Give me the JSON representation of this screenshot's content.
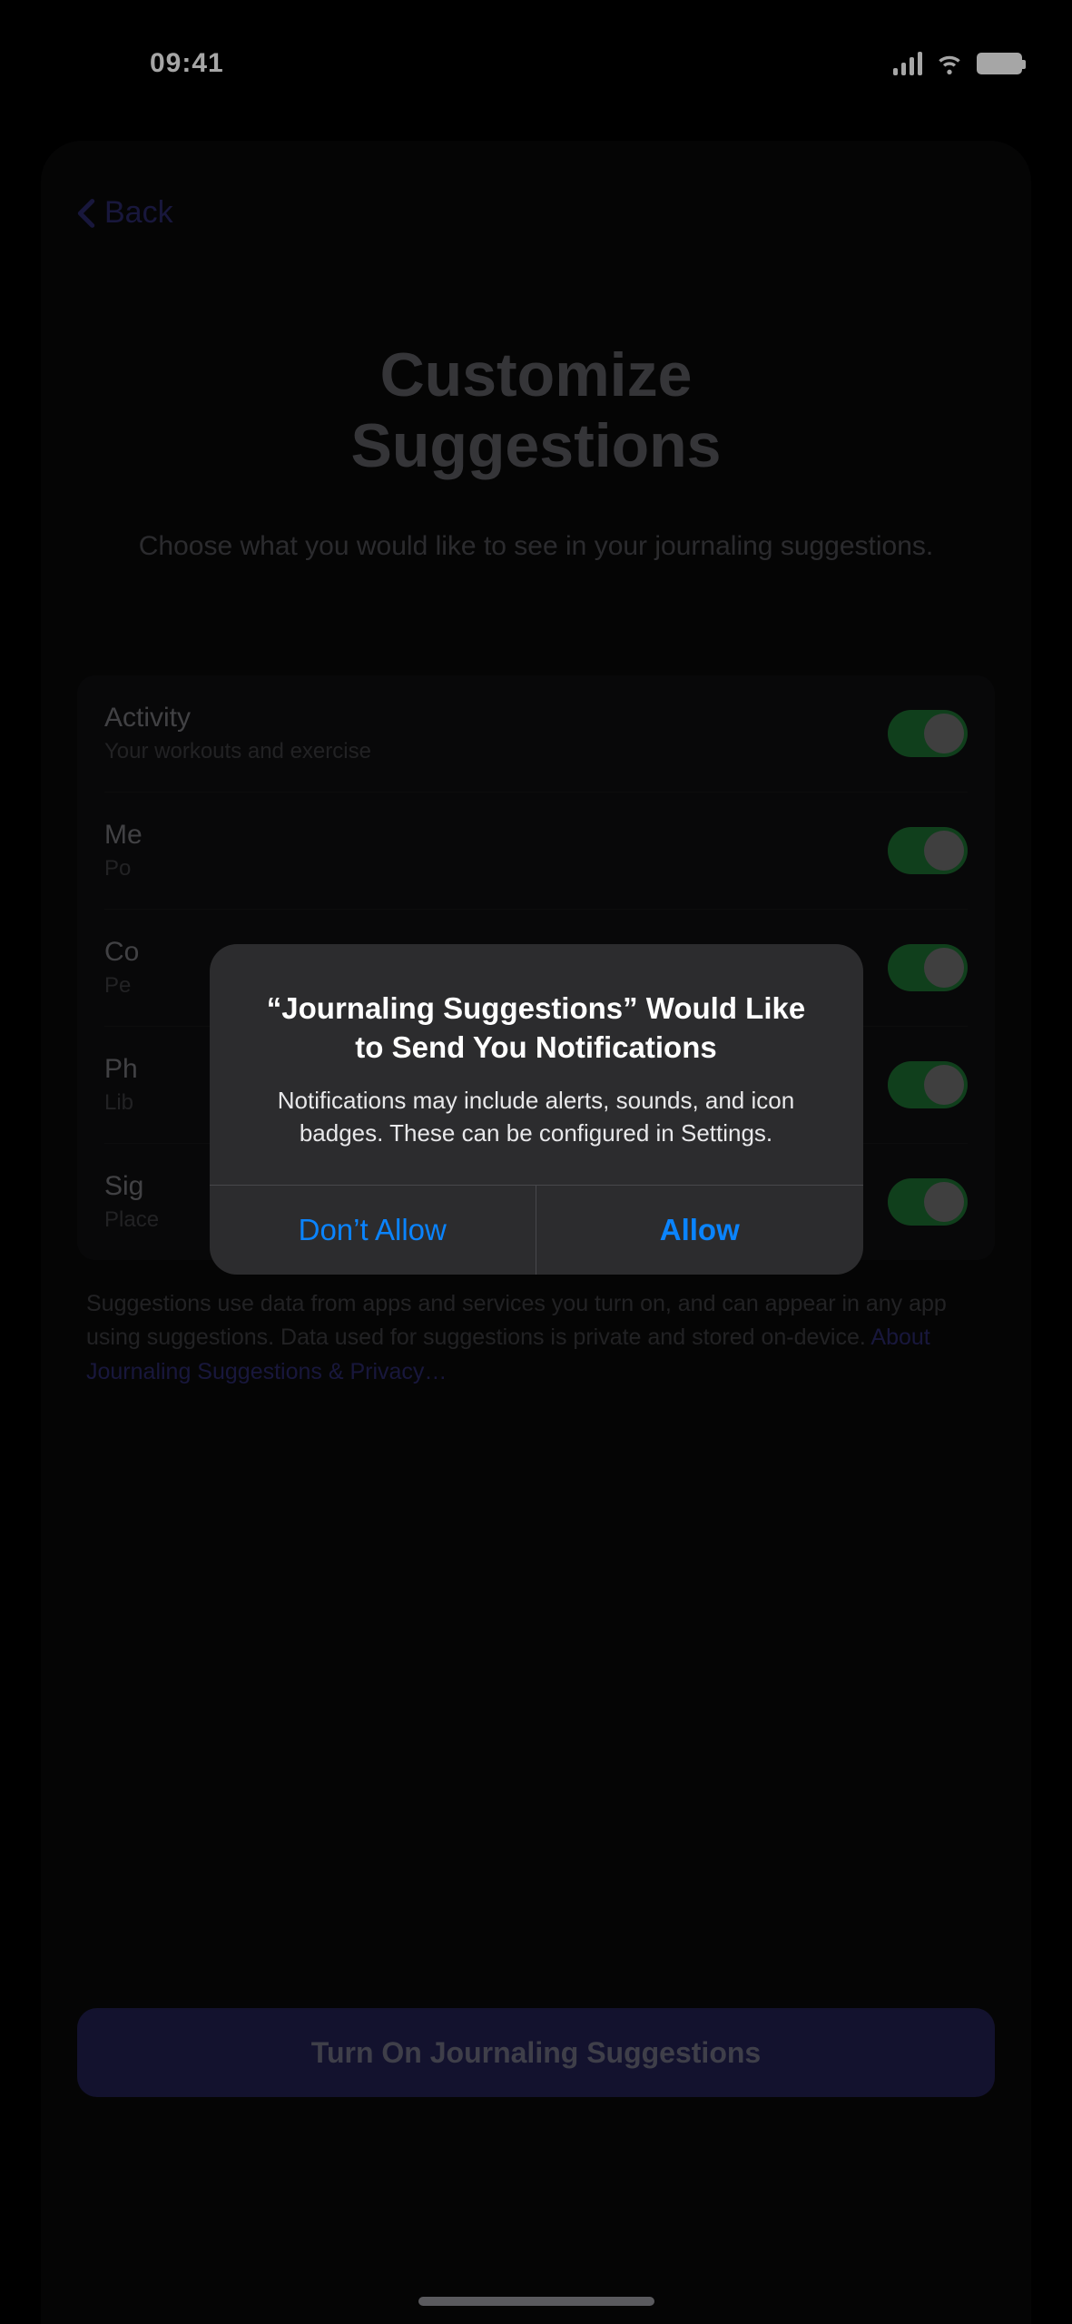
{
  "status": {
    "time": "09:41"
  },
  "nav": {
    "back": "Back"
  },
  "page": {
    "title_line1": "Customize",
    "title_line2": "Suggestions",
    "subtitle": "Choose what you would like to see in your journaling suggestions."
  },
  "options": {
    "activity": {
      "title": "Activity",
      "subtitle": "Your workouts and exercise"
    },
    "media": {
      "title": "Me",
      "subtitle": "Po"
    },
    "contacts": {
      "title": "Co",
      "subtitle": "Pe"
    },
    "photos": {
      "title": "Ph",
      "subtitle": "Lib"
    },
    "locations": {
      "title": "Sig",
      "subtitle": "Place"
    }
  },
  "footer": {
    "text": "Suggestions use data from apps and services you turn on, and can appear in any app using suggestions. Data used for suggestions is private and stored on-device. ",
    "link": "About Journaling Suggestions & Privacy…"
  },
  "primary_button": "Turn On Journaling Suggestions",
  "alert": {
    "title": "“Journaling Suggestions” Would Like to Send You Notifications",
    "message": "Notifications may include alerts, sounds, and icon badges. These can be configured in Settings.",
    "deny": "Don’t Allow",
    "allow": "Allow"
  }
}
